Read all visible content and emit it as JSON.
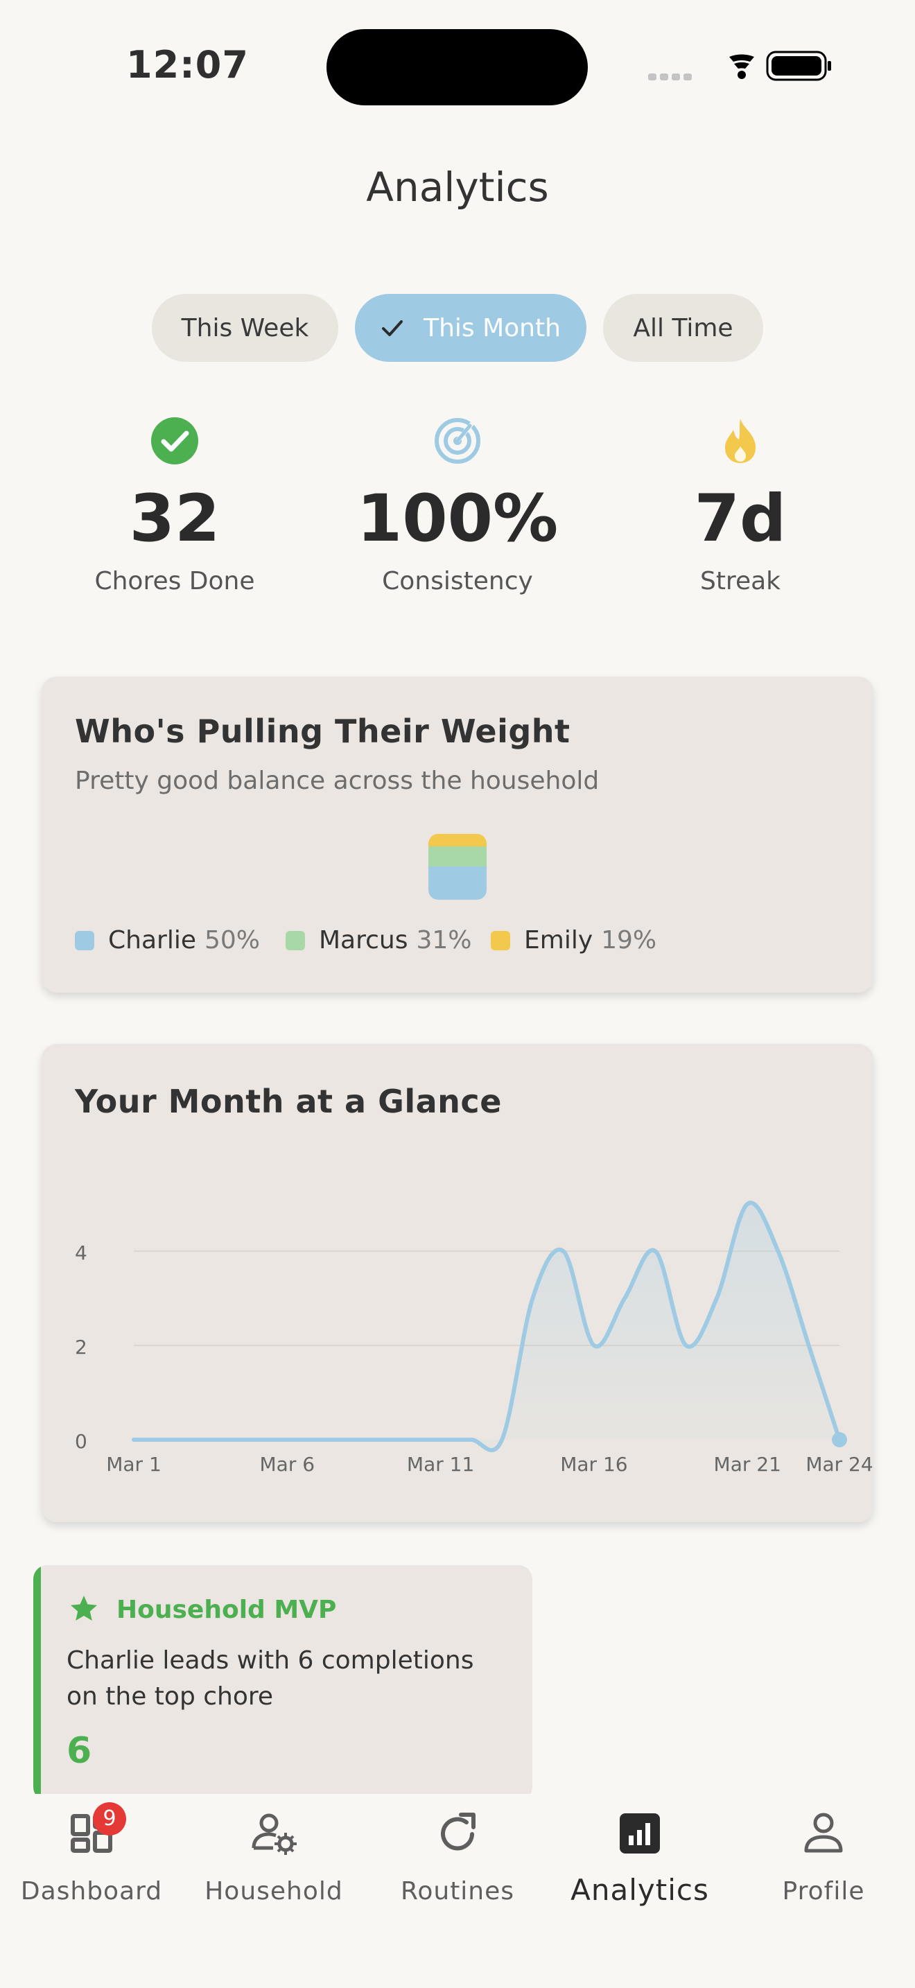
{
  "status_bar": {
    "time": "12:07"
  },
  "header": {
    "title": "Analytics"
  },
  "filters": [
    {
      "label": "This Week",
      "active": false
    },
    {
      "label": "This Month",
      "active": true
    },
    {
      "label": "All Time",
      "active": false
    }
  ],
  "stats": [
    {
      "icon": "check-circle-icon",
      "value": "32",
      "label": "Chores Done",
      "color": "#4caf50"
    },
    {
      "icon": "target-icon",
      "value": "100%",
      "label": "Consistency",
      "color": "#9ecae3"
    },
    {
      "icon": "flame-icon",
      "value": "7d",
      "label": "Streak",
      "color": "#f2c94c"
    }
  ],
  "balance_card": {
    "title": "Who's Pulling Their Weight",
    "subtitle": "Pretty good balance across the household",
    "members": [
      {
        "name": "Charlie",
        "pct": "50%",
        "share": 0.5,
        "color": "#9ecae3"
      },
      {
        "name": "Marcus",
        "pct": "31%",
        "share": 0.31,
        "color": "#a8d8a8"
      },
      {
        "name": "Emily",
        "pct": "19%",
        "share": 0.19,
        "color": "#f2c94c"
      }
    ]
  },
  "chart_card": {
    "title": "Your Month at a Glance"
  },
  "chart_data": {
    "type": "area",
    "title": "Your Month at a Glance",
    "x": [
      1,
      2,
      3,
      4,
      5,
      6,
      7,
      8,
      9,
      10,
      11,
      12,
      13,
      14,
      15,
      16,
      17,
      18,
      19,
      20,
      21,
      22,
      23,
      24
    ],
    "x_labels": [
      "Mar 1",
      "Mar 6",
      "Mar 11",
      "Mar 16",
      "Mar 21",
      "Mar 24"
    ],
    "x_label_positions": [
      1,
      6,
      11,
      16,
      21,
      24
    ],
    "y_ticks": [
      "0",
      "2",
      "4"
    ],
    "y_tick_values": [
      0,
      2,
      4
    ],
    "ylim": [
      0,
      5
    ],
    "series": [
      {
        "values": [
          0,
          0,
          0,
          0,
          0,
          0,
          0,
          0,
          0,
          0,
          0,
          0,
          0,
          3,
          4,
          2,
          3,
          4,
          2,
          3,
          5,
          4,
          2,
          0
        ]
      }
    ],
    "grid": true,
    "color": "#9ecae3"
  },
  "mvp_card": {
    "title": "Household MVP",
    "text": "Charlie leads with 6 completions on the top chore",
    "value": "6"
  },
  "nav": {
    "items": [
      {
        "label": "Dashboard",
        "icon": "dashboard-icon",
        "badge": "9"
      },
      {
        "label": "Household",
        "icon": "household-icon"
      },
      {
        "label": "Routines",
        "icon": "routines-icon"
      },
      {
        "label": "Analytics",
        "icon": "analytics-icon",
        "active": true
      },
      {
        "label": "Profile",
        "icon": "profile-icon"
      }
    ]
  }
}
